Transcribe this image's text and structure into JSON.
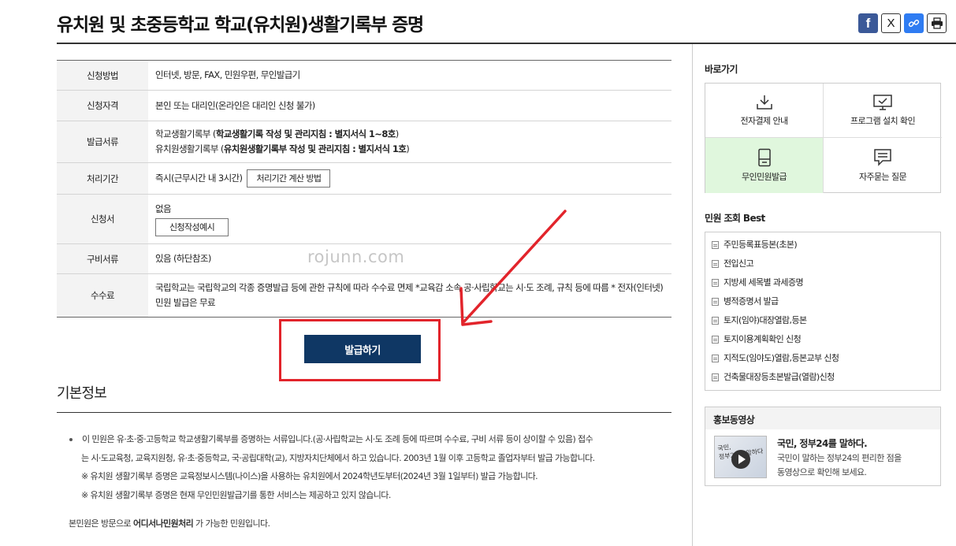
{
  "page": {
    "title": "유치원 및 초중등학교 학교(유치원)생활기록부 증명"
  },
  "share": {
    "facebook_label": "f",
    "x_label": "X"
  },
  "info_table": {
    "rows": [
      {
        "label": "신청방법",
        "value": "인터넷, 방문, FAX, 민원우편, 무인발급기"
      },
      {
        "label": "신청자격",
        "value": "본인 또는 대리인(온라인은 대리인 신청 불가)"
      },
      {
        "label": "발급서류",
        "line1_prefix": "학교생활기록부 (",
        "line1_bold": "학교생활기록 작성 및 관리지침 : 별지서식 1~8호",
        "line1_suffix": ")",
        "line2_prefix": "유치원생활기록부 (",
        "line2_bold": "유치원생활기록부 작성 및 관리지침 : 별지서식 1호",
        "line2_suffix": ")"
      },
      {
        "label": "처리기간",
        "value": "즉시(근무시간 내 3시간)",
        "button": "처리기간 계산 방법"
      },
      {
        "label": "신청서",
        "value": "없음",
        "button": "신청작성예시"
      },
      {
        "label": "구비서류",
        "value": "있음 (하단참조)"
      },
      {
        "label": "수수료",
        "value": "국립학교는 국립학교의 각종 증명발급 등에 관한 규칙에 따라 수수료 면제 *교육감 소속 공·사립학교는 시·도 조례, 규칙 등에 따름 * 전자(인터넷)민원 발급은 무료"
      }
    ]
  },
  "issue_button": "발급하기",
  "watermark": "rojunn.com",
  "basic_info": {
    "title": "기본정보",
    "line1": "이 민원은 유·초·중·고등학교 학교생활기록부를 증명하는 서류입니다.(공·사립학교는 시·도 조례 등에 따르며 수수료, 구비 서류 등이 상이할 수 있음) 접수",
    "line2": "는 시·도교육청, 교육지원청, 유·초·중등학교, 국·공립대학(교), 지방자치단체에서 하고 있습니다. 2003년 1월 이후 고등학교 졸업자부터 발급 가능합니다.",
    "line3": "※ 유치원 생활기록부 증명은 교육정보시스템(나이스)을 사용하는 유치원에서 2024학년도부터(2024년 3월 1일부터) 발급 가능합니다.",
    "line4": "※ 유치원 생활기록부 증명은 현재 무인민원발급기를 통한 서비스는 제공하고 있지 않습니다.",
    "note_prefix": "본민원은 방문으로 ",
    "note_bold": "어디서나민원처리",
    "note_suffix": " 가 가능한 민원입니다."
  },
  "sidebar": {
    "quick_title": "바로가기",
    "quick_items": [
      {
        "label": "전자결제 안내",
        "icon": "download-icon"
      },
      {
        "label": "프로그램 설치 확인",
        "icon": "monitor-icon"
      },
      {
        "label": "무인민원발급",
        "icon": "kiosk-icon"
      },
      {
        "label": "자주묻는 질문",
        "icon": "speech-bubble-icon"
      }
    ],
    "best_title": "민원 조회 Best",
    "best_items": [
      "주민등록표등본(초본)",
      "전입신고",
      "지방세 세목별 과세증명",
      "병적증명서 발급",
      "토지(임야)대장열람,등본",
      "토지이용계획확인 신청",
      "지적도(임야도)열람,등본교부 신청",
      "건축물대장등초본발급(열람)신청"
    ],
    "promo": {
      "title": "홍보동영상",
      "video_title": "국민, 정부24를 말하다.",
      "desc_line1": "국민이 말하는 정부24의 편리한 점을",
      "desc_line2": "동영상으로 확인해 보세요.",
      "thumb_text_1": "국민,",
      "thumb_text_2": "정부24를 말하다"
    }
  },
  "colors": {
    "primary_button": "#0f3764",
    "annotation_red": "#e2242b",
    "active_quick": "#e0f7dd",
    "facebook": "#3b5998",
    "link_blue": "#2f7cf2"
  }
}
